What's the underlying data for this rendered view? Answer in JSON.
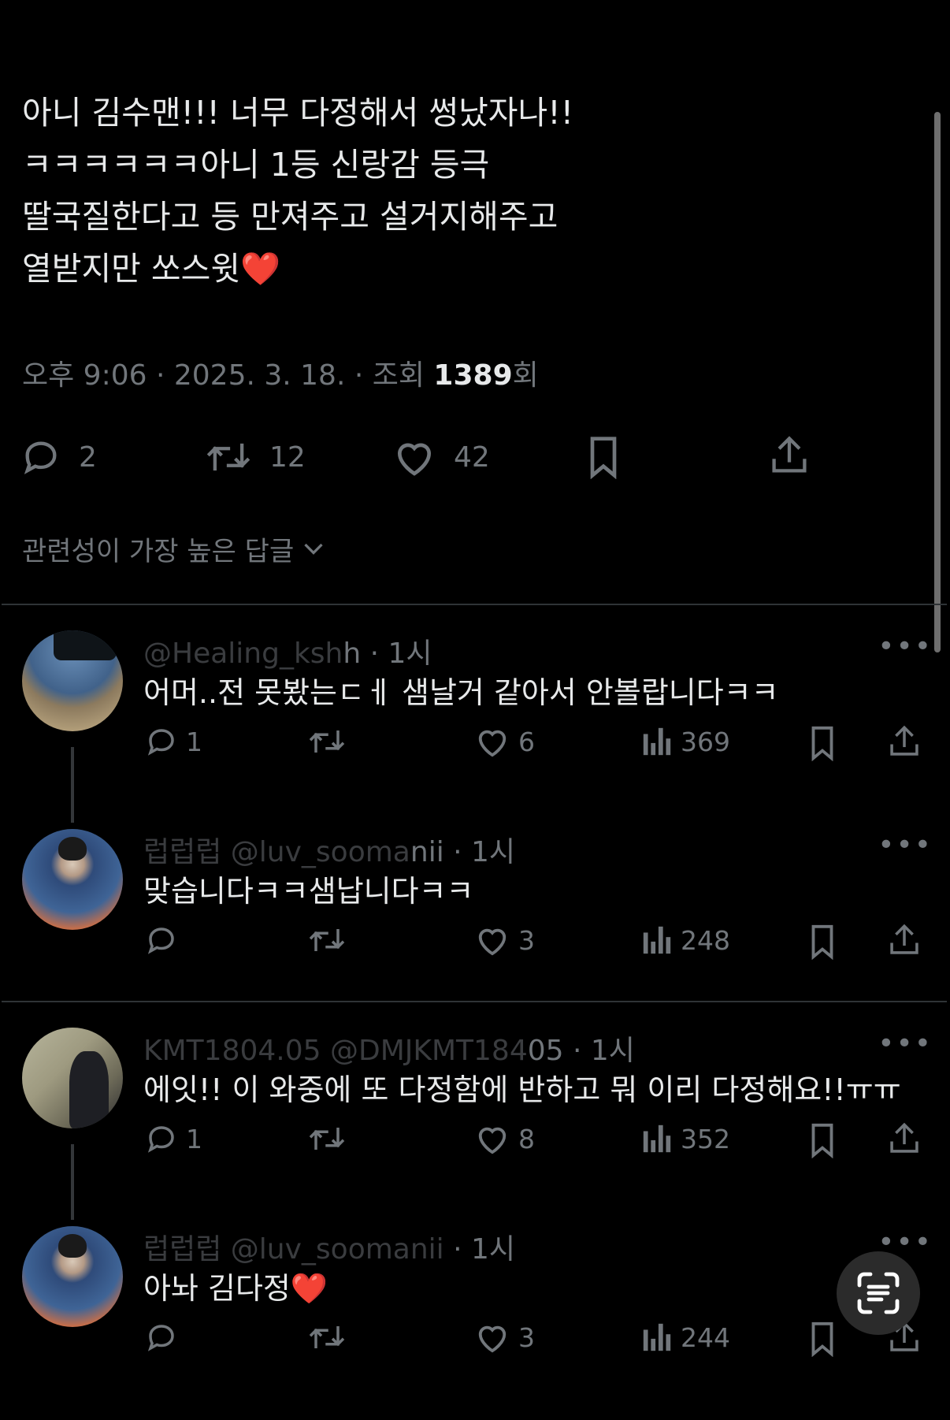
{
  "tweet": {
    "lines": [
      "아니 김수맨!!!  너무 다정해서 썽났자나!!",
      "ㅋㅋㅋㅋㅋㅋ아니 1등 신랑감 등극",
      "딸국질한다고 등 만져주고 설거지해주고",
      "열받지만  쏘스윗"
    ],
    "heart_emoji": "❤️",
    "meta_prefix": "오후 9:06 · 2025. 3. 18. · 조회 ",
    "views": "1389",
    "meta_suffix": "회",
    "replies": "2",
    "retweets": "12",
    "likes": "42"
  },
  "sort_label": "관련성이 가장 높은 답글",
  "replies": [
    {
      "handle_faded": "@Healing_ksh",
      "handle_visible": "h · 1시",
      "text": "어머..전 못봤는ㄷㅔ 샘날거 같아서 안볼랍니다ㅋㅋ",
      "replies": "1",
      "retweets": "",
      "likes": "6",
      "views": "369"
    },
    {
      "handle_faded": "럽럽럽 @luv_sooma",
      "handle_visible": "nii · 1시",
      "text": "맞습니다ㅋㅋ샘납니다ㅋㅋ",
      "replies": "",
      "retweets": "",
      "likes": "3",
      "views": "248"
    },
    {
      "handle_faded": "KMT1804.05 @DMJKMT184",
      "handle_visible": "05 · 1시",
      "text": "에잇!! 이 와중에 또 다정함에 반하고 뭐 이리 다정해요!!ㅠㅠ",
      "replies": "1",
      "retweets": "",
      "likes": "8",
      "views": "352"
    },
    {
      "handle_faded": "럽럽럽 @luv_soomanii",
      "handle_visible": " · 1시",
      "text": "아놔 김다정",
      "heart_emoji": "❤️",
      "replies": "",
      "retweets": "",
      "likes": "3",
      "views": "244"
    }
  ],
  "colors": {
    "background": "#000000",
    "text": "#e7e9ea",
    "muted": "#71767b",
    "heart": "#f0323c",
    "divider": "#2f3336"
  }
}
